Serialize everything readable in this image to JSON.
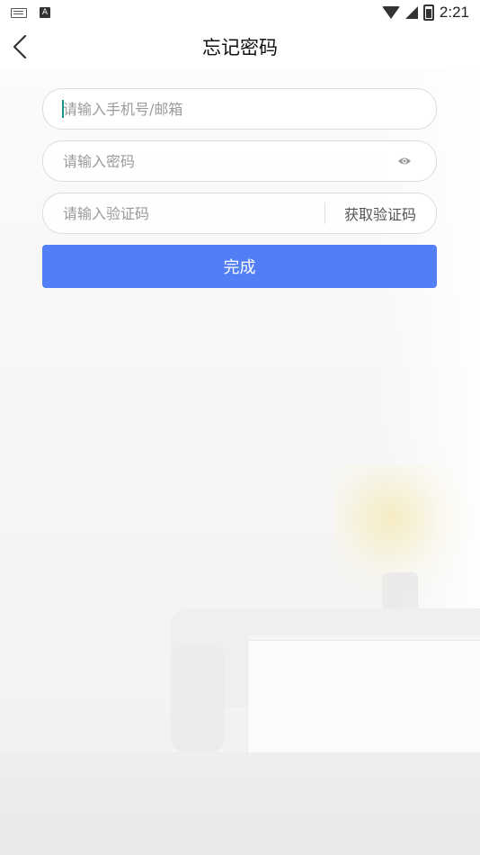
{
  "status_bar": {
    "left_icons": [
      "keyboard-icon",
      "a-notification-icon"
    ],
    "right_icons": [
      "wifi-icon",
      "cell-signal-icon",
      "battery-charging-icon"
    ],
    "time": "2:21"
  },
  "header": {
    "back_icon": "chevron-left-icon",
    "title": "忘记密码"
  },
  "form": {
    "account_placeholder": "请输入手机号/邮箱",
    "password_placeholder": "请输入密码",
    "password_toggle_icon": "eye-icon",
    "code_placeholder": "请输入验证码",
    "get_code_label": "获取验证码",
    "submit_label": "完成"
  },
  "colors": {
    "accent": "#527ef6",
    "cursor": "#199488",
    "input_border": "#dcdcdc"
  }
}
